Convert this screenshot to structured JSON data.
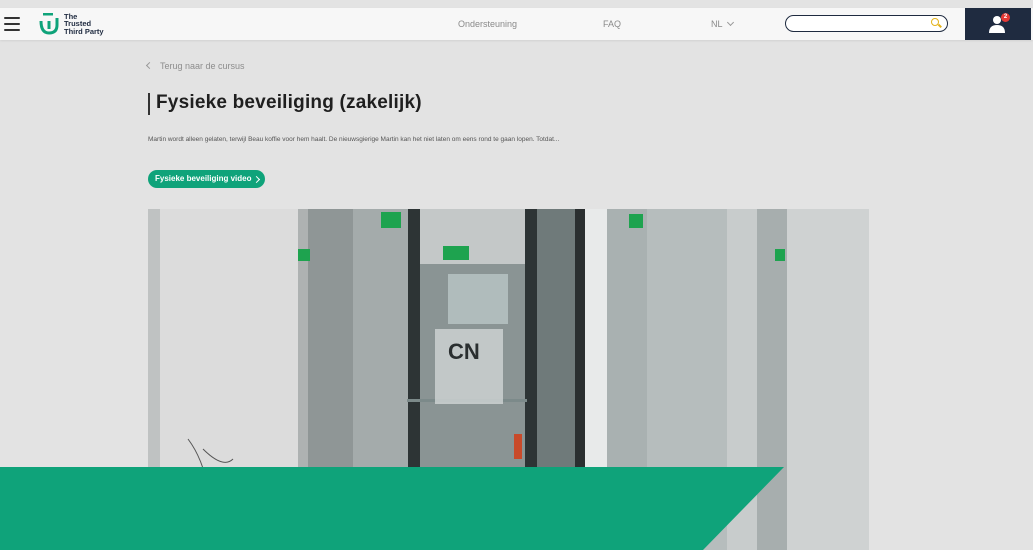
{
  "header": {
    "logo_lines": [
      "The",
      "Trusted",
      "Third Party"
    ],
    "nav": [
      {
        "label": "Ondersteuning"
      },
      {
        "label": "FAQ"
      }
    ],
    "language": "NL",
    "search": {
      "value": "",
      "placeholder": ""
    },
    "notification_count": "2",
    "colors": {
      "brand_navy": "#1f2b40",
      "brand_green": "#0fa37a",
      "notification_red": "#e53935"
    }
  },
  "page": {
    "back_link": "Terug naar de cursus",
    "title": "Fysieke beveiliging (zakelijk)",
    "description": "Martin wordt alleen gelaten, terwijl Beau koffie voor hem haalt. De nieuwsgierige Martin kan het niet laten om eens rond te gaan lopen. Totdat...",
    "video_button": "Fysieke beveiliging video",
    "video_logo_text": "CN"
  },
  "icons": [
    "hamburger-icon",
    "logo-icon",
    "chevron-down-icon",
    "search-icon",
    "user-icon",
    "chevron-left-icon",
    "chevron-right-icon"
  ]
}
